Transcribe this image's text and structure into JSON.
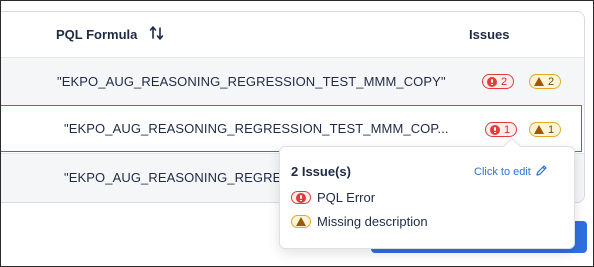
{
  "table": {
    "header_formula": "PQL Formula",
    "header_issues": "Issues",
    "rows": [
      {
        "formula": "\"EKPO_AUG_REASONING_REGRESSION_TEST_MMM_COPY\"",
        "errors": "2",
        "warnings": "2"
      },
      {
        "formula": "\"EKPO_AUG_REASONING_REGRESSION_TEST_MMM_COP...",
        "errors": "1",
        "warnings": "1"
      },
      {
        "formula": "\"EKPO_AUG_REASONING_REGRESS"
      }
    ]
  },
  "popover": {
    "title": "2 Issue(s)",
    "edit_label": "Click to edit",
    "issues": [
      {
        "label": "PQL Error",
        "kind": "error"
      },
      {
        "label": "Missing description",
        "kind": "warning"
      }
    ]
  },
  "colors": {
    "accent": "#2f6fe0",
    "error": "#e03c3c",
    "warning": "#e2a92a"
  }
}
